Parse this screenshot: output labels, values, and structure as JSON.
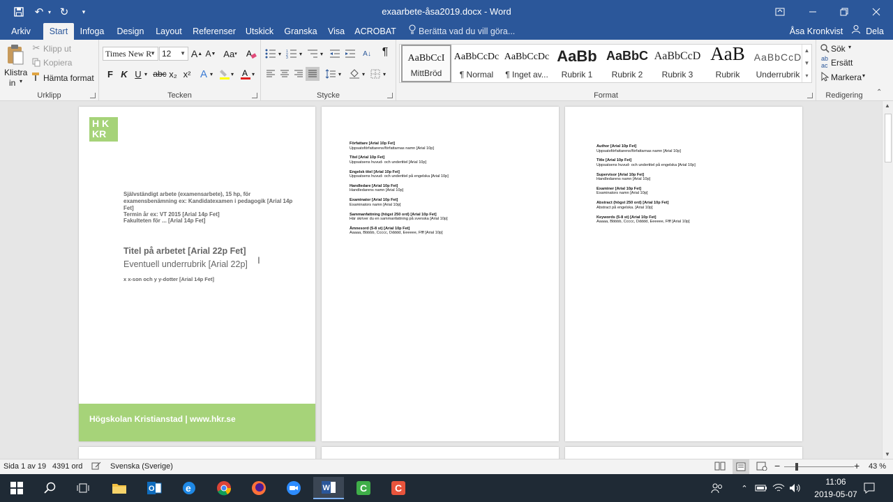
{
  "titlebar": {
    "doc_title": "exaarbete-åsa2019.docx - Word",
    "save_icon": "save-icon",
    "undo_icon": "undo-icon",
    "redo_icon": "redo-icon",
    "customize_icon": "customize-icon",
    "ribbon_display_icon": "ribbon-display-options-icon",
    "minimize_icon": "minimize-icon",
    "restore_icon": "restore-icon",
    "close_icon": "close-icon"
  },
  "tabs": [
    "Arkiv",
    "Start",
    "Infoga",
    "Design",
    "Layout",
    "Referenser",
    "Utskick",
    "Granska",
    "Visa",
    "ACROBAT"
  ],
  "tell_me": "Berätta vad du vill göra...",
  "user": "Åsa Kronkvist",
  "share": "Dela",
  "clipboard": {
    "paste": "Klistra",
    "paste2": "in",
    "cut": "Klipp ut",
    "copy": "Kopiera",
    "format_painter": "Hämta format",
    "label": "Urklipp"
  },
  "font": {
    "name": "Times New R",
    "size": "12",
    "bold": "F",
    "italic": "K",
    "underline": "U",
    "strike": "abc",
    "sub": "x₂",
    "sup": "x²",
    "grow": "A",
    "shrink": "A",
    "change_case": "Aa",
    "label": "Tecken"
  },
  "paragraph": {
    "label": "Stycke",
    "pilcrow": "¶"
  },
  "styles": {
    "label": "Format",
    "items": [
      {
        "sample": "AaBbCcI",
        "name": "MittBröd"
      },
      {
        "sample": "AaBbCcDc",
        "name": "¶ Normal"
      },
      {
        "sample": "AaBbCcDc",
        "name": "¶ Inget av..."
      },
      {
        "sample": "AaBb",
        "name": "Rubrik 1"
      },
      {
        "sample": "AaBbC",
        "name": "Rubrik 2"
      },
      {
        "sample": "AaBbCcD",
        "name": "Rubrik 3"
      },
      {
        "sample": "AaB",
        "name": "Rubrik"
      },
      {
        "sample": "AaBbCcD",
        "name": "Underrubrik"
      }
    ]
  },
  "editing": {
    "find": "Sök",
    "replace": "Ersätt",
    "select": "Markera",
    "label": "Redigering"
  },
  "page1": {
    "logo_top": "H K",
    "logo_bottom": "KR",
    "line1": "Självständigt arbete (examensarbete), 15 hp, för",
    "line2": "examensbenämning ex: Kandidatexamen i pedagogik [Arial 14p",
    "line3": "Fet]",
    "line4": "Termin år ex: VT 2015 [Arial 14p Fet]",
    "line5": "Fakulteten för ... [Arial 14p Fet]",
    "title": "Titel på arbetet [Arial 22p Fet]",
    "subtitle": "Eventuell underrubrik [Arial 22p]",
    "author": "x x-son och y y-dotter [Arial 14p Fet]",
    "footer": "Högskolan Kristianstad | www.hkr.se"
  },
  "page2": {
    "items": [
      {
        "h": "Författare [Arial 10p Fet]",
        "t": "Uppsatsförfattarens/författarnas namn [Arial 10p]"
      },
      {
        "h": "Titel [Arial 10p Fet]",
        "t": "Uppsatsens huvud- och undertitel [Arial 10p]"
      },
      {
        "h": "Engelsk titel [Arial 10p Fet]",
        "t": "Uppsatsens huvud- och undertitel på engelska [Arial 10p]"
      },
      {
        "h": "Handledare [Arial 10p Fet]",
        "t": "Handledarens namn [Arial 10p]"
      },
      {
        "h": "Examinator [Arial 10p Fet]",
        "t": "Examinators namn [Arial 10p]"
      },
      {
        "h": "Sammanfattning (högst 250 ord) [Arial 10p Fet]",
        "t": "Här skriver du en sammanfattning på svenska [Arial 10p]"
      },
      {
        "h": "Ämnesord (5-8 st) [Arial 10p Fet]",
        "t": "Aaaaa, Bbbbb, Ccccc, Ddddd, Eeeeee, Ffff [Arial 10p]"
      }
    ]
  },
  "page3": {
    "items": [
      {
        "h": "Author [Arial 10p Fet]",
        "t": "Uppsatsförfattarens/författarnas namn [Arial 10p]"
      },
      {
        "h": "Title [Arial 10p Fet]",
        "t": "Uppsatsens huvud- och undertitel på engelska [Arial 10p]"
      },
      {
        "h": "Supervisor [Arial 10p Fet]",
        "t": "Handledarens namn [Arial 10p]"
      },
      {
        "h": "Examiner [Arial 10p Fet]",
        "t": "Examinators namn [Arial 10p]"
      },
      {
        "h": "Abstract (högst 250 ord) [Arial 10p Fet]",
        "t": "Abstract på engelska. [Arial 10p]"
      },
      {
        "h": "Keywords (5-8 st) [Arial 10p Fet]",
        "t": "Aaaaa, Bbbbb, Ccccc, Ddddd, Eeeeee, Ffff [Arial 10p]"
      }
    ]
  },
  "status": {
    "page": "Sida 1 av 19",
    "words": "4391 ord",
    "language": "Svenska (Sverige)",
    "zoom": "43 %",
    "zoom_fraction": 0.43
  },
  "taskbar": {
    "time": "11:06",
    "date": "2019-05-07"
  },
  "colors": {
    "word_blue": "#2b579a",
    "hkr_green": "#a6d379",
    "taskbar": "#1f2a35"
  }
}
